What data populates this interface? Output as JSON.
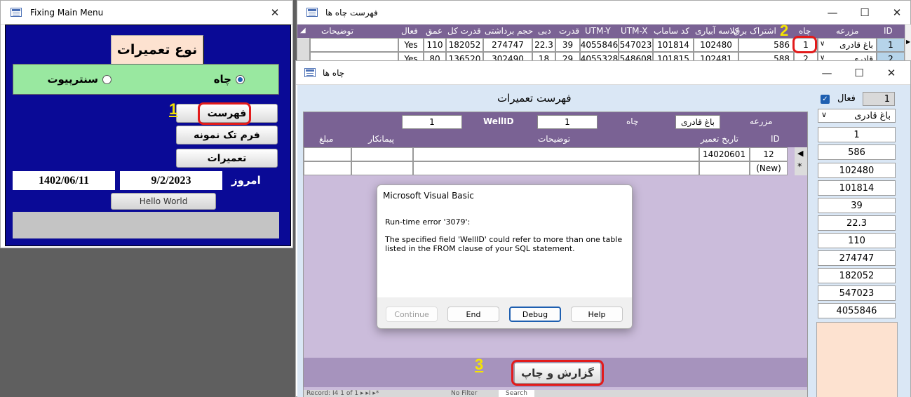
{
  "main_menu": {
    "title": "Fixing Main Menu",
    "heading": "نوع تعميرات",
    "radio_well": "چاه",
    "radio_pivot": "سنترپيوت",
    "btn_list": "فهرست",
    "btn_single_form": "فرم تک نمونه",
    "btn_repairs": "تعميرات",
    "today_label": "امروز",
    "date_gregorian": "9/2/2023",
    "date_persian": "1402/06/11",
    "hello_button": "Hello World"
  },
  "wells_list": {
    "title": "فهرست چاه ها",
    "columns": [
      "ID",
      "مزرعه",
      "چاه",
      "اشتراک برق",
      "کلاسه آبیاری",
      "کد ساماب",
      "UTM-X",
      "UTM-Y",
      "قدرت",
      "دبی",
      "حجم برداشتی",
      "قدرت کل",
      "عمق",
      "فعال",
      "توضیحات"
    ],
    "row1": [
      "1",
      "باغ قادری",
      "1",
      "586",
      "102480",
      "101814",
      "547023",
      "4055846",
      "39",
      "22.3",
      "274747",
      "182052",
      "110",
      "Yes",
      ""
    ],
    "row2": [
      "2",
      "قادری",
      "2",
      "588",
      "102481",
      "101815",
      "548608",
      "4055328",
      "29",
      "18",
      "302490",
      "136520",
      "80",
      "Yes",
      ""
    ]
  },
  "wells_form": {
    "title": "چاه ها",
    "active_label": "فعال",
    "id_value": "1",
    "farm_value": "باغ قادری",
    "fields": [
      "1",
      "586",
      "102480",
      "101814",
      "39",
      "22.3",
      "110",
      "274747",
      "182052",
      "547023",
      "4055846"
    ],
    "repairs_title": "فهرست تعميرات",
    "farm_label": "مزرعه",
    "farm_box": "باغ قادری",
    "well_label": "چاه",
    "well_value": "1",
    "wellid_label": "WellID",
    "wellid_value": "1",
    "sub_columns": [
      "ID",
      "تاريخ تعمير",
      "توضيحات",
      "پيمانکار",
      "مبلغ"
    ],
    "sub_row_id": "12",
    "sub_row_date": "14020601",
    "new_row": "(New)",
    "report_button": "گزارش و چاپ",
    "record_nav": "Record: I4   1 of 1   ▸  ▸I  ▸*",
    "no_filter": "No Filter",
    "search": "Search"
  },
  "dialog": {
    "title": "Microsoft Visual Basic",
    "error_line": "Run-time error '3079':",
    "message": "The specified field 'WellID' could refer to more than one table listed in the FROM clause of your SQL statement.",
    "btn_continue": "Continue",
    "btn_end": "End",
    "btn_debug": "Debug",
    "btn_help": "Help"
  },
  "annotations": {
    "step1": "1",
    "step2": "2",
    "step3": "3"
  },
  "colors": {
    "navy": "#0a0a96",
    "purple_header": "#7a6294",
    "lavender": "#cbbcdb",
    "green": "#99e8a0",
    "accent_red": "#e21b1b",
    "annotation_yellow": "#f5e400"
  }
}
